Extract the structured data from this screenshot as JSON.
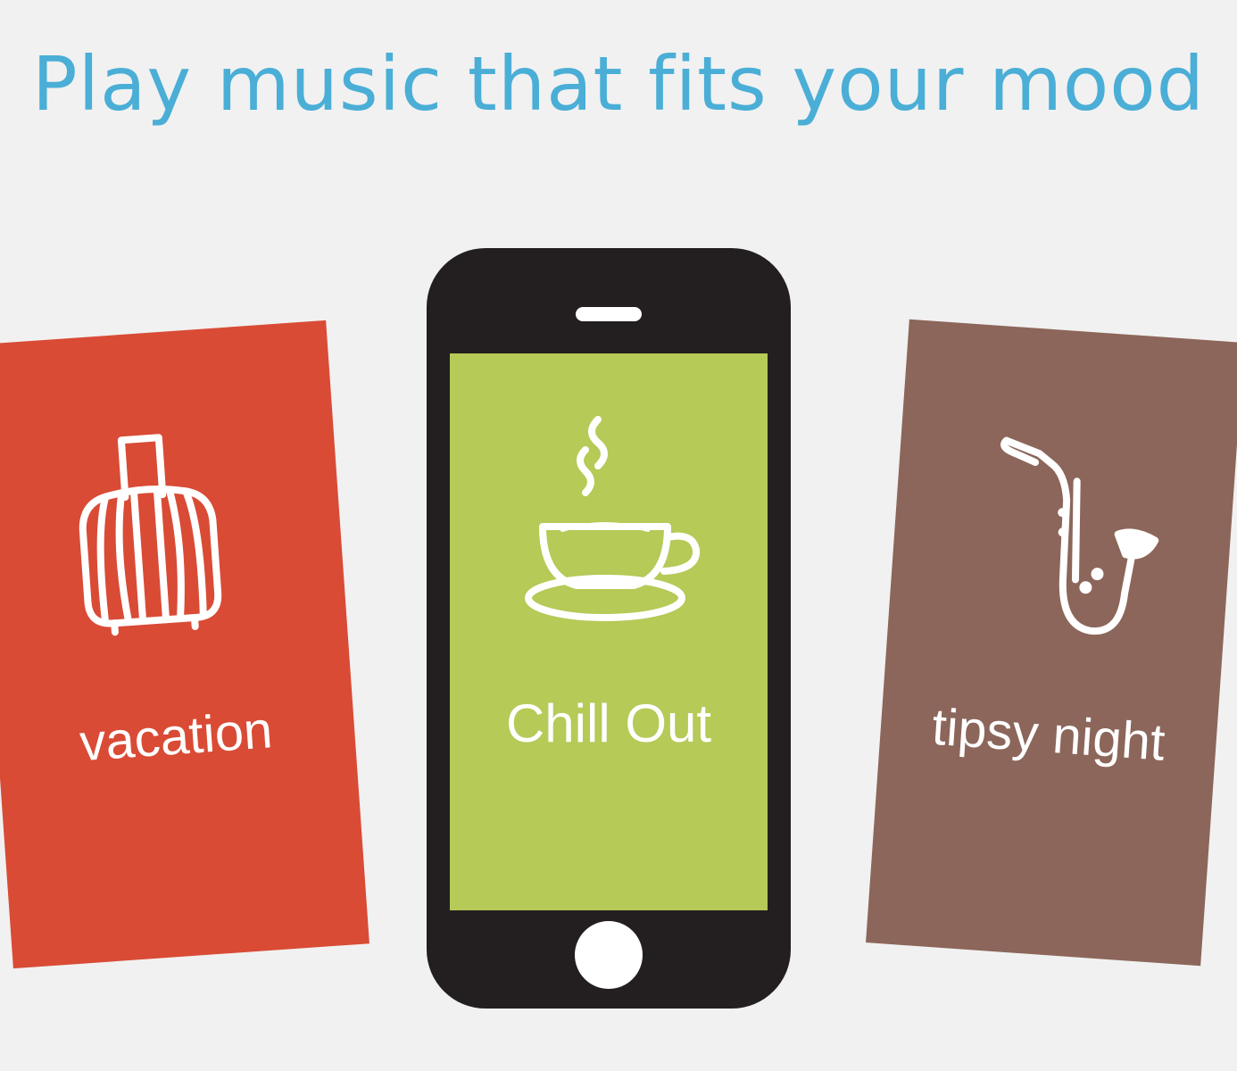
{
  "headline": {
    "text": "Play music that fits your mood",
    "color": "#4aaed6"
  },
  "cards": {
    "vacation": {
      "label": "vacation",
      "icon": "suitcase-icon",
      "color": "#d94b35"
    },
    "chill_out": {
      "label": "Chill Out",
      "icon": "coffee-cup-icon",
      "color": "#b5ca57"
    },
    "tipsy_night": {
      "label": "tipsy night",
      "icon": "saxophone-icon",
      "color": "#8c665a"
    }
  }
}
